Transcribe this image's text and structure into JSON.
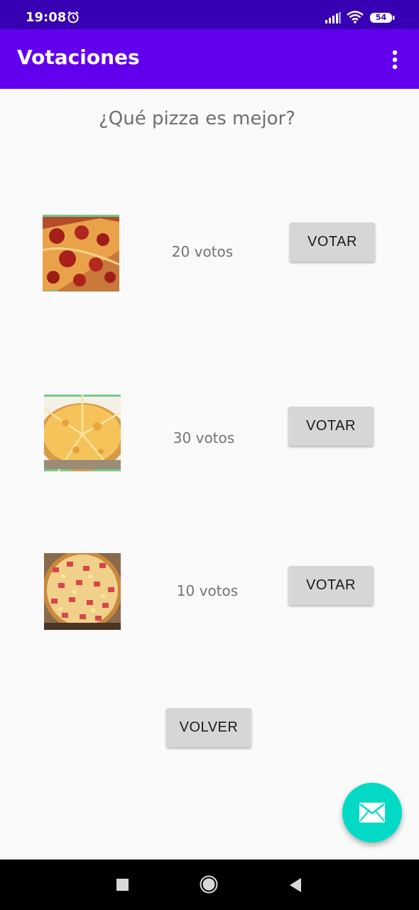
{
  "status_bar": {
    "time": "19:08",
    "battery": "54"
  },
  "app_bar": {
    "title": "Votaciones"
  },
  "main": {
    "question": "¿Qué pizza es mejor?",
    "pizzas": [
      {
        "image": "pepperoni-pizza-photo",
        "votes_label": "20 votos",
        "button_label": "VOTAR"
      },
      {
        "image": "cheese-pizza-photo",
        "votes_label": "30 votos",
        "button_label": "VOTAR"
      },
      {
        "image": "hawaiian-pizza-photo",
        "votes_label": "10 votos",
        "button_label": "VOTAR"
      }
    ],
    "back_button_label": "VOLVER"
  },
  "colors": {
    "status_bar": "#3700b3",
    "app_bar": "#6200ee",
    "fab": "#03dac5",
    "button": "#d6d6d6"
  }
}
